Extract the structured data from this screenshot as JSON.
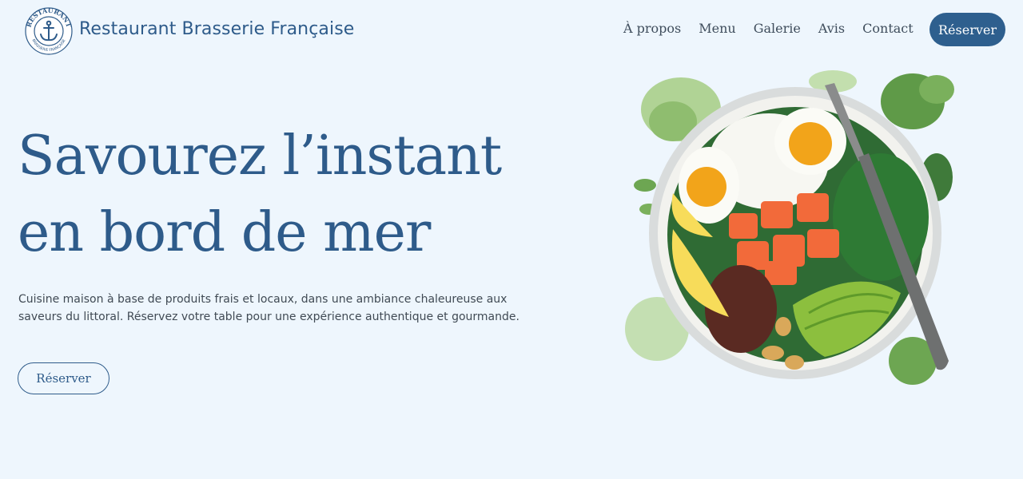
{
  "header": {
    "logo": {
      "name": "anchor-logo",
      "top_text": "RESTAURANT",
      "bottom_text": "BRASSERIE FRANÇAISE"
    },
    "brand_name": "Restaurant Brasserie Française",
    "nav": [
      {
        "label": "À propos"
      },
      {
        "label": "Menu"
      },
      {
        "label": "Galerie"
      },
      {
        "label": "Avis"
      },
      {
        "label": "Contact"
      }
    ],
    "cta_label": "Réserver"
  },
  "hero": {
    "title_line1": "Savourez l’instant",
    "title_line2": "en bord de mer",
    "description": "Cuisine maison à base de produits frais et locaux, dans une ambiance chaleureuse aux saveurs du littoral. Réservez votre table pour une expérience authentique et gourmande.",
    "cta_label": "Réserver",
    "image": "poke-bowl-image"
  },
  "colors": {
    "background": "#eef6fd",
    "brand_blue": "#2e5b8a",
    "cta_fill": "#2e5f8e",
    "body_text": "#404a54"
  }
}
